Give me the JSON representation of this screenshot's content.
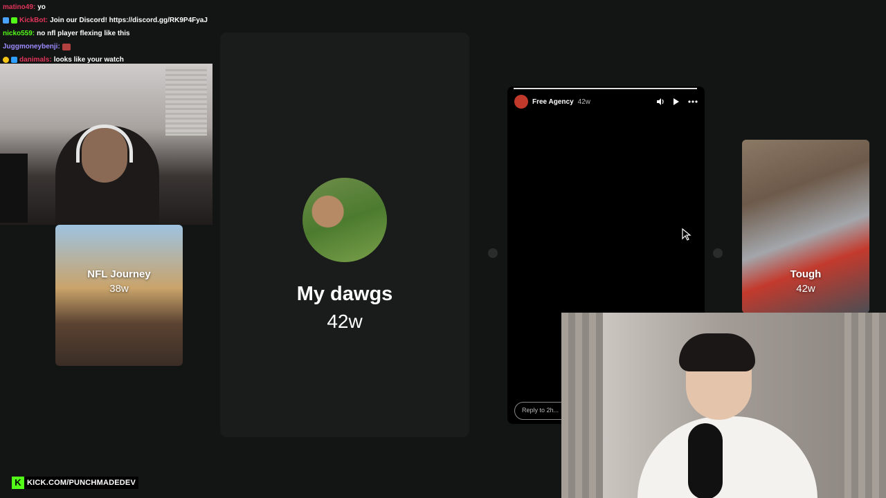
{
  "chat": {
    "lines": [
      {
        "user": "matino49:",
        "message": "yo",
        "color": "#e0345a"
      },
      {
        "user": "KickBot:",
        "message": "Join our Discord! https://discord.gg/RK9P4FyaJ",
        "color": "#e0345a"
      },
      {
        "user": "nicko559:",
        "message": "no nfl player flexing like this",
        "color": "#53fc18"
      },
      {
        "user": "Juggmoneybenji:",
        "message": "",
        "color": "#9b8cff"
      },
      {
        "user": "danimals:",
        "message": "looks like your watch",
        "color": "#e0345a"
      }
    ]
  },
  "stories": {
    "left": {
      "title": "NFL Journey",
      "age": "38w"
    },
    "center": {
      "title": "My dawgs",
      "age": "42w"
    },
    "right": {
      "title": "Tough",
      "age": "42w"
    }
  },
  "player": {
    "name": "Free Agency",
    "age": "42w",
    "progress": 1.0,
    "reply_placeholder": "Reply to 2h...",
    "controls": {
      "mute_icon": "speaker-icon",
      "play_icon": "play-icon",
      "more_icon": "more-icon"
    }
  },
  "branding": {
    "logo": "K",
    "text": "KICK.COM/PUNCHMADEDEV",
    "color": "#53fc18"
  }
}
